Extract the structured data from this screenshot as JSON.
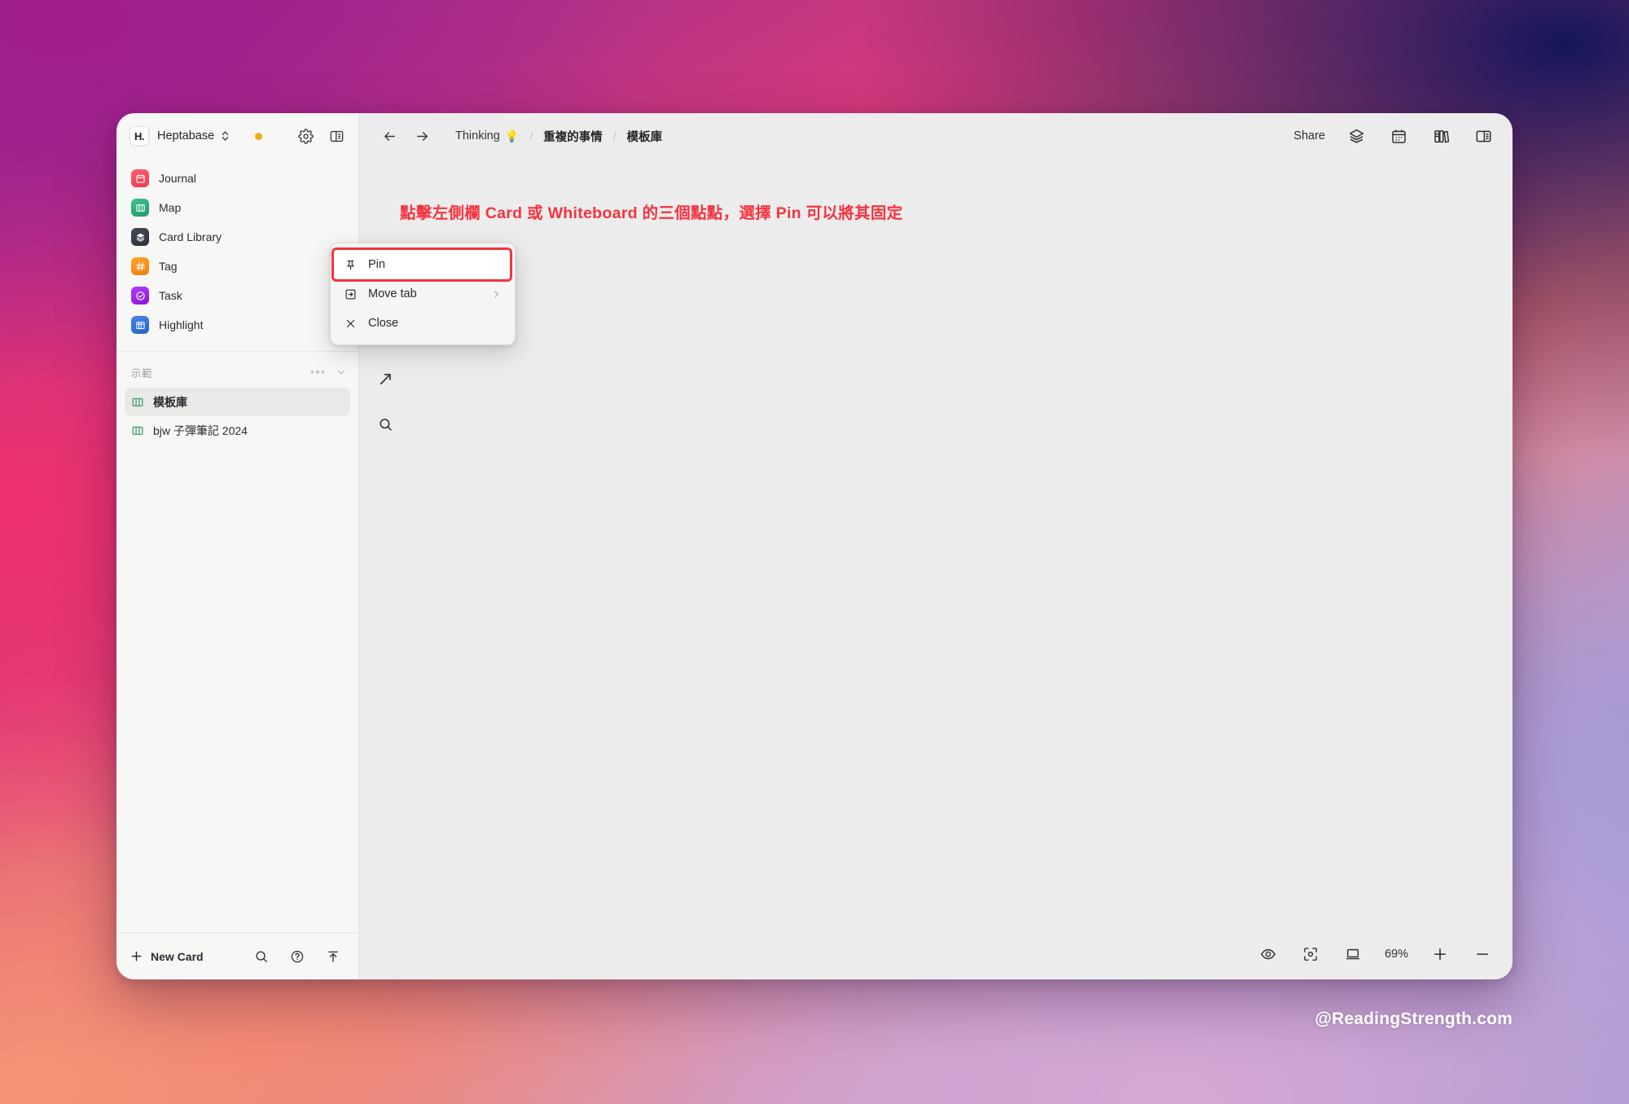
{
  "window": {
    "app_title": "Heptabase",
    "logo_text": "H."
  },
  "sidebar": {
    "nav_items": [
      {
        "label": "Journal",
        "icon": "calendar-icon",
        "color": "#f2485b"
      },
      {
        "label": "Map",
        "icon": "map-icon",
        "color": "#2faa79"
      },
      {
        "label": "Card Library",
        "icon": "layers-icon",
        "color": "#343b44"
      },
      {
        "label": "Tag",
        "icon": "hash-icon",
        "color": "#f39019"
      },
      {
        "label": "Task",
        "icon": "check-circle-icon",
        "color": "#9b25e0"
      },
      {
        "label": "Highlight",
        "icon": "highlight-icon",
        "color": "#2d6fd6"
      }
    ],
    "section": {
      "title": "示範",
      "more_icon": "three-dots-icon",
      "collapse_icon": "chevron-down-icon"
    },
    "tree_items": [
      {
        "label": "模板庫",
        "icon": "whiteboard-icon",
        "active": true
      },
      {
        "label": "bjw 子彈筆記 2024",
        "icon": "whiteboard-icon",
        "active": false
      }
    ],
    "footer": {
      "new_card_label": "New Card",
      "new_card_icon": "plus-icon",
      "search_icon": "search-icon",
      "help_icon": "question-circle-icon",
      "upload_icon": "upload-icon"
    },
    "header_icons": {
      "switcher_icon": "chevron-up-down-icon",
      "status_dot": "amber-dot",
      "status_dot_color": "#e8ae18",
      "settings_icon": "gear-icon",
      "panel_toggle_icon": "sidebar-toggle-icon"
    }
  },
  "topbar": {
    "back_icon": "arrow-left-icon",
    "forward_icon": "arrow-right-icon",
    "breadcrumbs": [
      {
        "label": "Thinking",
        "emoji": "💡",
        "strong": false
      },
      {
        "label": "重複的事情",
        "emoji": "",
        "strong": true
      },
      {
        "label": "模板庫",
        "emoji": "",
        "strong": true
      }
    ],
    "separator": "/",
    "share_label": "Share",
    "icons": [
      {
        "name": "layers-icon"
      },
      {
        "name": "calendar-icon"
      },
      {
        "name": "bookshelf-icon"
      },
      {
        "name": "right-panel-icon"
      }
    ]
  },
  "canvas": {
    "annotation_text": "點擊左側欄 Card 或 Whiteboard 的三個點點，選擇 Pin 可以將其固定",
    "annotation_color": "#f5333f",
    "tools": [
      {
        "name": "cursor-tool",
        "active": true
      },
      {
        "name": "arrow-tool",
        "active": false
      },
      {
        "name": "magnifier-tool",
        "active": false
      }
    ]
  },
  "context_menu": {
    "items": [
      {
        "label": "Pin",
        "icon": "pin-icon",
        "highlighted": true,
        "has_submenu": false
      },
      {
        "label": "Move tab",
        "icon": "move-tab-icon",
        "highlighted": false,
        "has_submenu": true
      },
      {
        "label": "Close",
        "icon": "close-x-icon",
        "highlighted": false,
        "has_submenu": false
      }
    ],
    "highlight_color": "#f5333f"
  },
  "zoombar": {
    "zoom_level": "69%",
    "icons": [
      {
        "name": "eye-icon"
      },
      {
        "name": "focus-icon"
      },
      {
        "name": "present-icon"
      }
    ],
    "zoom_in_icon": "plus-icon",
    "zoom_out_icon": "minus-icon"
  },
  "watermark": {
    "text": "@ReadingStrength.com"
  }
}
